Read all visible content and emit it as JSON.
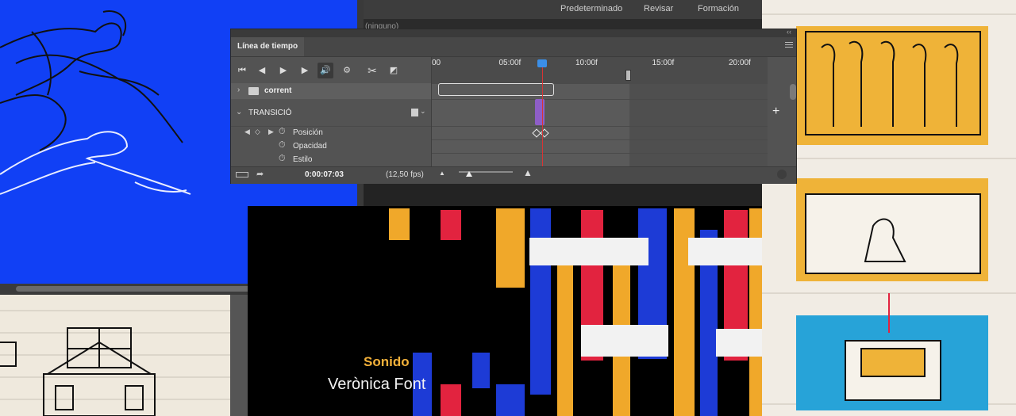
{
  "top_bar": {
    "workspaces": [
      "Predeterminado",
      "Revisar",
      "Formación"
    ],
    "secondary_text": "(ninguno)"
  },
  "timeline": {
    "panel_title": "Línea de tiempo",
    "collapse_glyph": "‹‹",
    "toolbar": {
      "go_first": "⏮",
      "prev_frame": "◀",
      "play": "▶",
      "next_frame": "▶",
      "audio": "🔊",
      "settings": "⚙",
      "split": "✂",
      "transition": "◩"
    },
    "ruler_ticks": [
      "00",
      "05:00f",
      "10:00f",
      "15:00f",
      "20:00f"
    ],
    "ruler_values_sec": [
      0,
      5,
      10,
      15,
      20
    ],
    "playhead_time_sec": 7.12,
    "layers": [
      {
        "name": "corrent",
        "type": "group"
      }
    ],
    "group": {
      "name": "TRANSICIÓ"
    },
    "properties": [
      "Posición",
      "Opacidad",
      "Estilo"
    ],
    "current_time": "0:00:07:03",
    "fps": "(12,50 fps)",
    "add_track": "+"
  },
  "video": {
    "credit_role": "Sonido",
    "credit_name": "Verònica Font"
  },
  "colors": {
    "canvas_blue": "#1140f5",
    "playhead": "#d83434",
    "transition_purple": "#8e5ec7",
    "credit_orange": "#f3b13a"
  }
}
